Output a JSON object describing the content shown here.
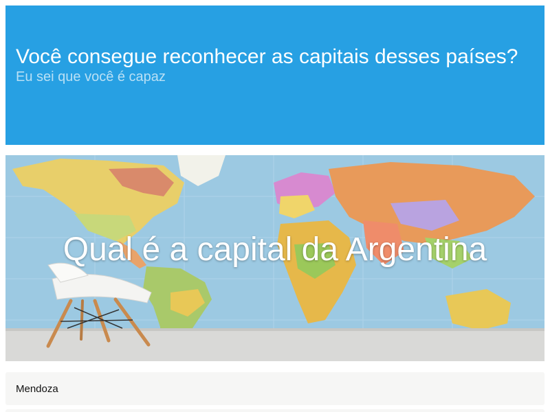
{
  "quiz": {
    "title": "Você consegue reconhecer as capitais desses países?",
    "subtitle": "Eu sei que você é capaz"
  },
  "question": {
    "text": "Qual é a capital da Argentina",
    "image": "world-map-wallpaper-with-chair"
  },
  "answers": [
    {
      "label": "Mendoza"
    }
  ],
  "colors": {
    "header_bg": "#27a0e3",
    "header_title": "#ffffff",
    "header_subtitle": "#b9e0f5",
    "answer_bg": "#f6f6f5"
  }
}
